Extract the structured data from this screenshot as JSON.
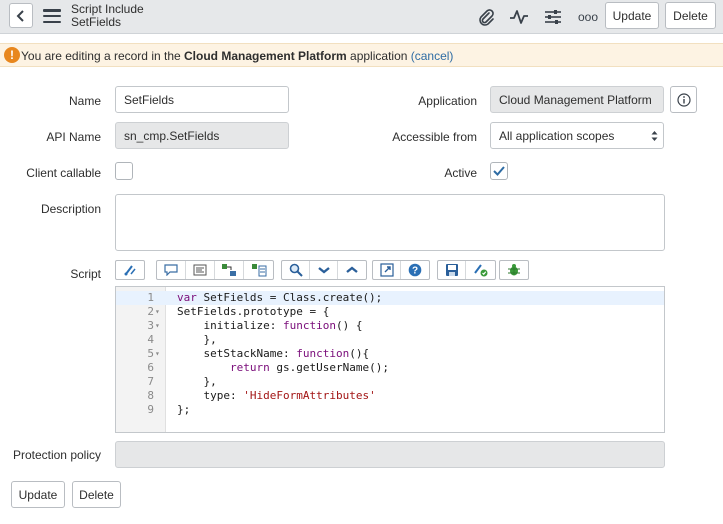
{
  "header": {
    "title": "Script Include",
    "subtitle": "SetFields",
    "icons": [
      "back-chevron-icon",
      "hamburger-menu-icon",
      "attachment-paperclip-icon",
      "activity-pulse-icon",
      "sliders-settings-icon",
      "more-dots-icon"
    ],
    "more_label": "ooo",
    "update_label": "Update",
    "delete_label": "Delete"
  },
  "banner": {
    "prefix": "You are editing a record in the ",
    "app_name": "Cloud Management Platform",
    "suffix": " application ",
    "cancel_link": "(cancel)",
    "icon_glyph": "!",
    "color": "#e8871e"
  },
  "form": {
    "name": {
      "label": "Name",
      "value": "SetFields"
    },
    "api_name": {
      "label": "API Name",
      "value": "sn_cmp.SetFields"
    },
    "client_callable": {
      "label": "Client callable",
      "checked": false
    },
    "description": {
      "label": "Description",
      "value": ""
    },
    "application": {
      "label": "Application",
      "value": "Cloud Management Platform"
    },
    "accessible_from": {
      "label": "Accessible from",
      "value": "All application scopes"
    },
    "active": {
      "label": "Active",
      "checked": true
    },
    "script": {
      "label": "Script"
    },
    "protection_policy": {
      "label": "Protection policy",
      "value": ""
    }
  },
  "toolbar": {
    "icons": [
      "syntax-check-icon",
      "comment-icon",
      "format-code-icon",
      "replace-icon",
      "replace-all-icon",
      "search-icon",
      "toggle-down-icon",
      "toggle-up-icon",
      "fullscreen-icon",
      "help-icon",
      "save-icon",
      "script-debugger-icon",
      "bug-icon"
    ]
  },
  "script_lines": [
    {
      "num": "1",
      "fold": "",
      "text": "var SetFields = Class.create();"
    },
    {
      "num": "2",
      "fold": "▾",
      "text": "SetFields.prototype = {"
    },
    {
      "num": "3",
      "fold": "▾",
      "text": "    initialize: function() {"
    },
    {
      "num": "4",
      "fold": "",
      "text": "    },"
    },
    {
      "num": "5",
      "fold": "▾",
      "text": "    setStackName: function(){"
    },
    {
      "num": "6",
      "fold": "",
      "text": "        return gs.getUserName();"
    },
    {
      "num": "7",
      "fold": "",
      "text": "    },"
    },
    {
      "num": "8",
      "fold": "",
      "text": "    type: 'HideFormAttributes'"
    },
    {
      "num": "9",
      "fold": "",
      "text": "};"
    }
  ],
  "footer": {
    "update_label": "Update",
    "delete_label": "Delete"
  },
  "colors": {
    "accent": "#2e6ca4",
    "checkmark": "#2e6ca4",
    "banner_bg": "#fdf3e3"
  }
}
